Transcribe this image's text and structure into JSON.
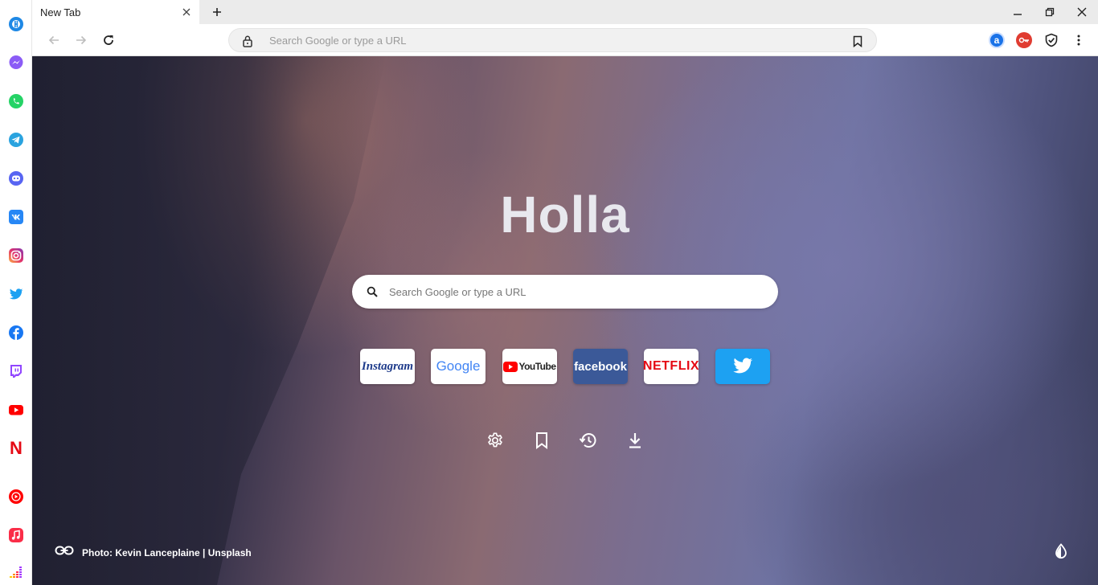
{
  "sidebar": {
    "items": [
      {
        "name": "holla-icon",
        "color": "#1e88e5"
      },
      {
        "name": "messenger-icon",
        "color": "#8b5cf6"
      },
      {
        "name": "whatsapp-icon",
        "color": "#25d366"
      },
      {
        "name": "telegram-icon",
        "color": "#2aa3df"
      },
      {
        "name": "discord-icon",
        "color": "#5865f2"
      },
      {
        "name": "vk-icon",
        "color": "#2787f5"
      },
      {
        "name": "instagram-icon",
        "color": "#e1306c"
      },
      {
        "name": "twitter-icon",
        "color": "#1da1f2"
      },
      {
        "name": "facebook-icon",
        "color": "#1877f2"
      },
      {
        "name": "twitch-icon",
        "color": "#9146ff"
      },
      {
        "name": "youtube-icon",
        "color": "#ff0000"
      },
      {
        "name": "netflix-icon",
        "color": "#e50914"
      },
      {
        "name": "youtube-music-icon",
        "color": "#ff0000"
      },
      {
        "name": "apple-music-icon",
        "color": "#fa2d48"
      },
      {
        "name": "deezer-icon",
        "color": "#a238ff"
      }
    ],
    "netflix_letter": "N"
  },
  "tabs": [
    {
      "title": "New Tab"
    }
  ],
  "toolbar": {
    "omnibox_placeholder": "Search Google or type a URL",
    "extensions": [
      {
        "name": "translate-extension-icon",
        "letter": "a",
        "color": "#1a73e8"
      },
      {
        "name": "password-extension-icon",
        "letter": "",
        "color": "#e03c31"
      },
      {
        "name": "shield-extension-icon",
        "letter": "",
        "color": "#222222"
      }
    ]
  },
  "main": {
    "headline": "Holla",
    "search_placeholder": "Search Google or type a URL",
    "shortcuts": [
      {
        "name": "Instagram",
        "label": "Instagram",
        "bg": "#ffffff",
        "fg": "#1d3a8a"
      },
      {
        "name": "Google",
        "label": "Google",
        "bg": "#ffffff",
        "fg": "#4285f4"
      },
      {
        "name": "YouTube",
        "label": "YouTube",
        "bg": "#ffffff",
        "fg": "#222222"
      },
      {
        "name": "Facebook",
        "label": "facebook",
        "bg": "#3b5998",
        "fg": "#ffffff"
      },
      {
        "name": "Netflix",
        "label": "NETFLIX",
        "bg": "#ffffff",
        "fg": "#e50914"
      },
      {
        "name": "Twitter",
        "label": "",
        "bg": "#1da1f2",
        "fg": "#ffffff"
      }
    ],
    "actions": [
      "settings-icon",
      "bookmark-icon",
      "history-icon",
      "download-icon"
    ],
    "photo_credit": "Photo: Kevin Lanceplaine | Unsplash"
  }
}
